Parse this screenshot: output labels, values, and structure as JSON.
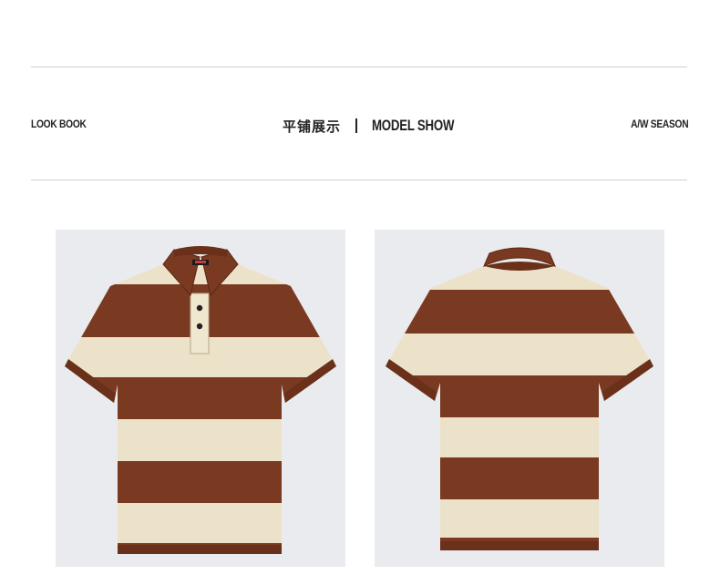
{
  "header": {
    "left_label": "LOOK BOOK",
    "title_cn": "平铺展示",
    "separator": "|",
    "title_en": "MODEL SHOW",
    "right_label": "A/W SEASON"
  },
  "gallery": {
    "items": [
      {
        "view": "front",
        "icon": "polo-shirt-front-icon"
      },
      {
        "view": "back",
        "icon": "polo-shirt-back-icon"
      }
    ],
    "colors": {
      "stripe_dark": "#7a3a22",
      "stripe_light": "#ece2c9",
      "panel_bg": "#e9ebee"
    }
  }
}
